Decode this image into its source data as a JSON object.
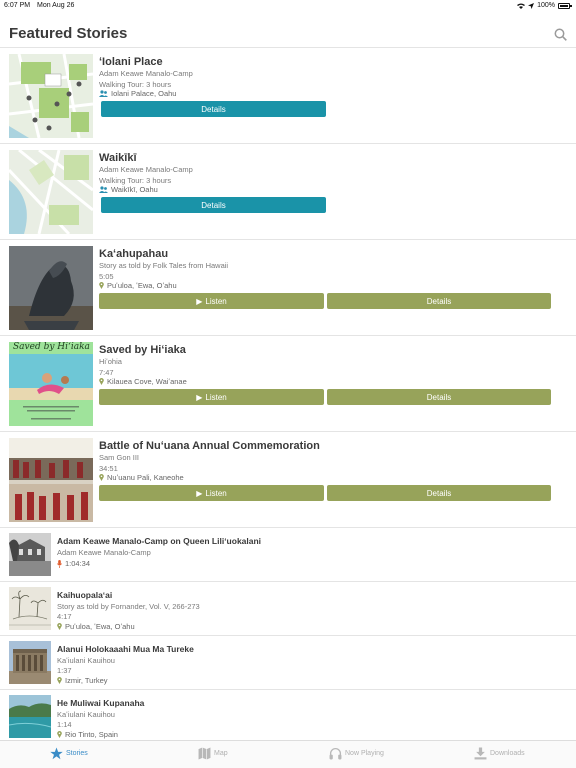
{
  "status_bar": {
    "time": "6:07 PM",
    "date": "Mon Aug 26",
    "battery": "100%"
  },
  "header": {
    "title": "Featured Stories"
  },
  "featured": [
    {
      "title": "ʻIolani Place",
      "author": "Adam Keawe Manalo-Camp",
      "meta": "Walking Tour: 3 hours",
      "location": "Iolani Palace, Oahu",
      "details_label": "Details"
    },
    {
      "title": "Waikīkī",
      "author": "Adam Keawe Manalo-Camp",
      "meta": "Walking Tour: 3 hours",
      "location": "Waikīkī, Oahu",
      "details_label": "Details"
    },
    {
      "title": "Kaʻahupahau",
      "author": "Story as told by Folk Tales from Hawaii",
      "meta": "5:05",
      "location": "Puʻuloa, ʻEwa, Oʻahu",
      "listen_label": "Listen",
      "details_label": "Details"
    },
    {
      "title": "Saved by Hiʻiaka",
      "author": "Hiʻohia",
      "meta": "7:47",
      "location": "Kilauea Cove, Waiʻanae",
      "listen_label": "Listen",
      "details_label": "Details",
      "cover_text": "Saved by Hiʻiaka"
    },
    {
      "title": "Battle of Nuʻuana Annual Commemoration",
      "author": "Sam Gon III",
      "meta": "34:51",
      "location": "Nuʻuanu Pali, Kaneohe",
      "listen_label": "Listen",
      "details_label": "Details"
    }
  ],
  "small": [
    {
      "title": "Adam Keawe Manalo-Camp on Queen Liliʻuokalani",
      "author": "Adam Keawe Manalo-Camp",
      "duration": "1:04:34"
    },
    {
      "title": "Kaihuopalaʻai",
      "author": "Story as told by Fornander, Vol. V, 266-273",
      "duration": "4:17",
      "location": "Puʻuloa, ʻEwa, Oʻahu"
    },
    {
      "title": "Alanui Holokaaahi Mua Ma Tureke",
      "author": "Kaʻiulani Kauihou",
      "duration": "1:37",
      "location": "Izmir, Turkey"
    },
    {
      "title": "He Muliwai Kupanaha",
      "author": "Kaʻiulani Kauihou",
      "duration": "1:14",
      "location": "Rio Tinto, Spain"
    }
  ],
  "tabs": [
    {
      "label": "Stories",
      "icon": "star-icon"
    },
    {
      "label": "Map",
      "icon": "map-icon"
    },
    {
      "label": "Now Playing",
      "icon": "headphones-icon"
    },
    {
      "label": "Downloads",
      "icon": "download-icon"
    }
  ],
  "colors": {
    "teal": "#1a93a8",
    "olive": "#97a35a",
    "pin": "#97a35a",
    "mic": "#e05a2b",
    "tab_active": "#3a8cc7"
  }
}
